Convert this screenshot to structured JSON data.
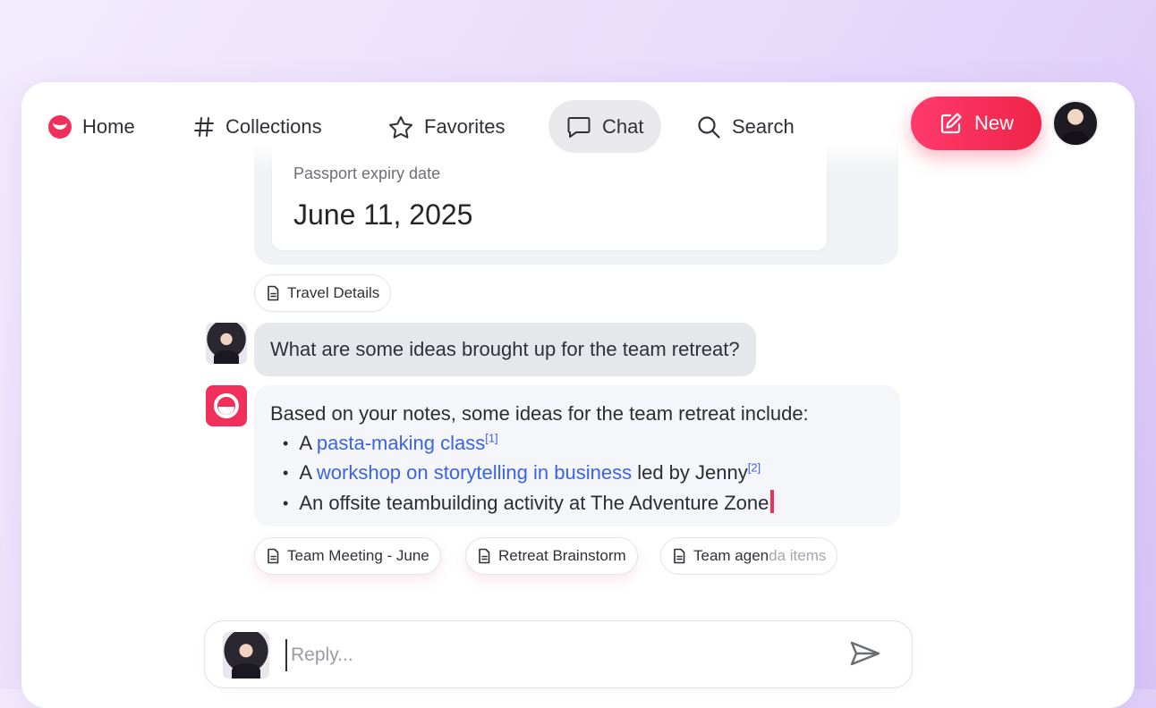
{
  "nav": {
    "items": [
      {
        "label": "Home",
        "icon": "brand-logo-icon"
      },
      {
        "label": "Collections",
        "icon": "hash-icon"
      },
      {
        "label": "Favorites",
        "icon": "star-icon"
      },
      {
        "label": "Chat",
        "icon": "chat-bubble-icon",
        "active": true
      },
      {
        "label": "Search",
        "icon": "search-icon"
      }
    ],
    "new_label": "New",
    "new_icon": "edit-pencil-icon"
  },
  "colors": {
    "accent": "#f0305b",
    "link": "#3b63e6",
    "active_tab_bg": "#e9e9ec"
  },
  "chat": {
    "previous_answer": {
      "label": "Passport expiry date",
      "value": "June 11, 2025",
      "sources": [
        "Travel Details"
      ]
    },
    "user_message": "What are some ideas brought up for the team retreat?",
    "ai_message": {
      "intro": "Based on your notes, some ideas for the team retreat include:",
      "bullet1": {
        "prefix": "A ",
        "link": "pasta-making class",
        "cite": "[1]"
      },
      "bullet2": {
        "prefix": "A ",
        "link": "workshop on storytelling in business",
        "suffix": " led by Jenny",
        "cite": "[2]"
      },
      "bullet3": {
        "text": "An offsite teambuilding activity at The Adventure Zone"
      }
    },
    "sources": [
      {
        "label": "Team Meeting - June"
      },
      {
        "label": "Retreat Brainstorm"
      },
      {
        "label_a": "Team agen",
        "label_b": "da items"
      }
    ]
  },
  "composer": {
    "placeholder": "Reply...",
    "send_icon": "send-icon"
  }
}
